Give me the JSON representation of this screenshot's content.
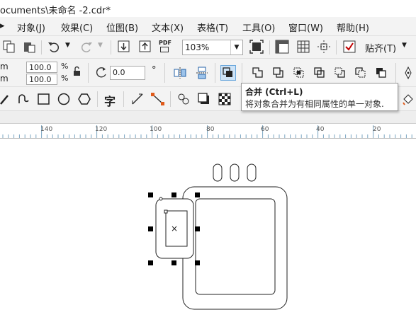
{
  "window": {
    "title": "ocuments\\未命名 -2.cdr*"
  },
  "menu": {
    "items": [
      "对象(J)",
      "效果(C)",
      "位图(B)",
      "文本(X)",
      "表格(T)",
      "工具(O)",
      "窗口(W)",
      "帮助(H)"
    ]
  },
  "toolbar": {
    "zoom_value": "103%",
    "pdf_label": "PDF",
    "snap_label": "贴齐(T)"
  },
  "properties": {
    "unit_1": "m",
    "unit_2": "m",
    "scale_x": "100.0",
    "scale_y": "100.0",
    "percent_1": "%",
    "percent_2": "%",
    "rotation": "0.0",
    "degree": "°"
  },
  "toolbox": {
    "text_tool_glyph": "字"
  },
  "tooltip": {
    "title": "合并 (Ctrl+L)",
    "description": "将对象合并为有相同属性的单一对象."
  },
  "ruler": {
    "labels": [
      "140",
      "120",
      "100",
      "80",
      "60",
      "40",
      "20"
    ]
  },
  "canvas": {
    "center_mark": "×"
  }
}
